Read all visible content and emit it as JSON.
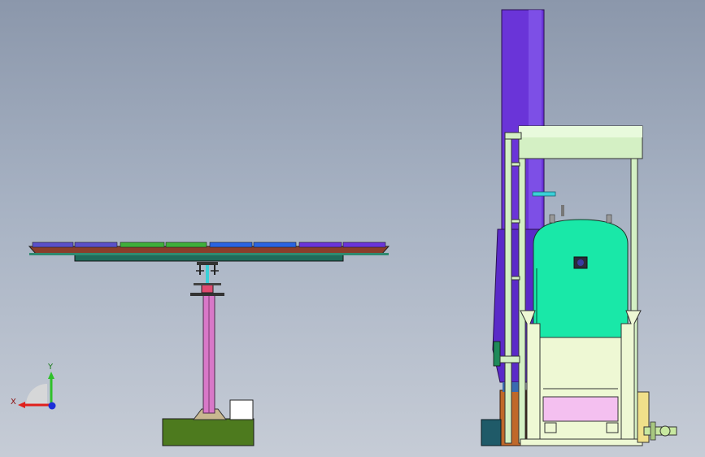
{
  "viewport": {
    "background_top": "#8b97ab",
    "background_bottom": "#c6ccd6"
  },
  "triad": {
    "x_label": "X",
    "y_label": "Y",
    "x_color": "#e0201c",
    "y_color": "#2fc02a",
    "z_color": "#1c2fd8"
  },
  "scene": {
    "heliostat_panel_colors": [
      "#5a4fc8",
      "#3fae3a",
      "#2a63e0",
      "#6a34d8"
    ],
    "tower_color": "#6a34d8",
    "tank_color": "#19e8a8",
    "frame_color": "#d4f0c4",
    "base_color": "#4d7a1e",
    "pole_color": "#d878c8"
  }
}
